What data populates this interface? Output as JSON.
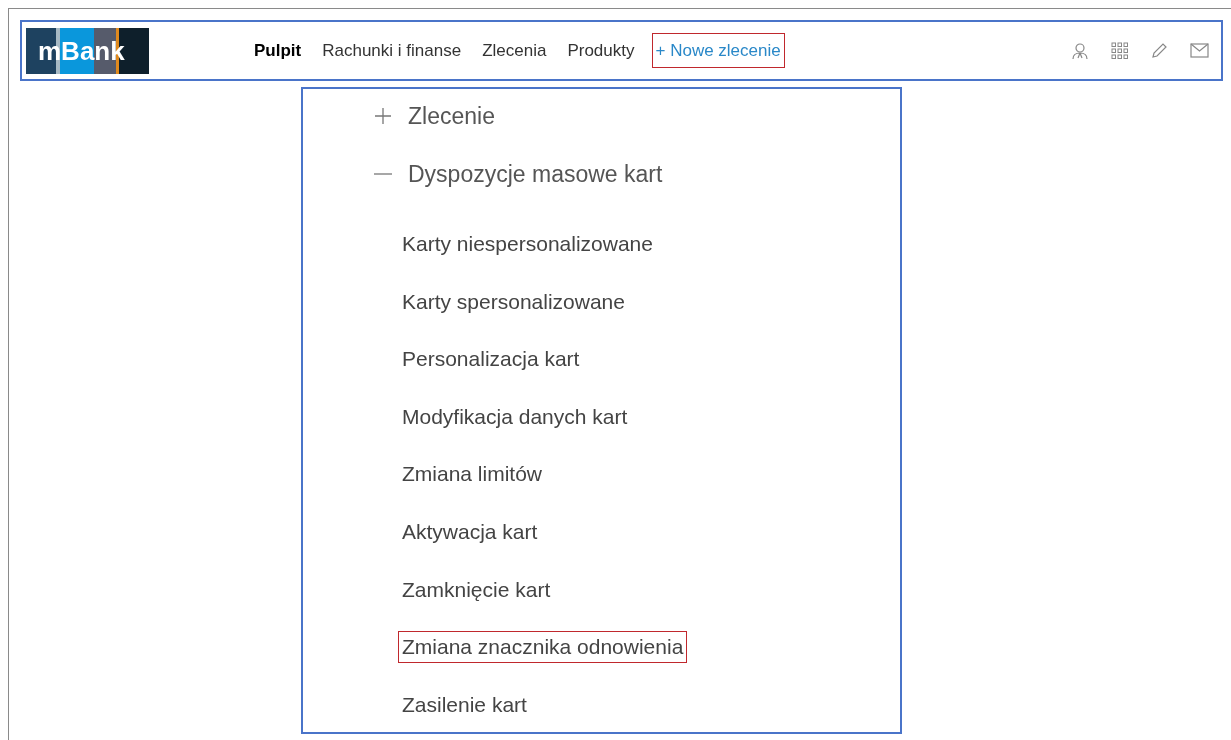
{
  "logo": {
    "text": "mBank"
  },
  "nav": [
    {
      "label": "Pulpit",
      "selected": true,
      "highlighted": false
    },
    {
      "label": "Rachunki i finanse",
      "selected": false,
      "highlighted": false
    },
    {
      "label": "Zlecenia",
      "selected": false,
      "highlighted": false
    },
    {
      "label": "Produkty",
      "selected": false,
      "highlighted": false
    },
    {
      "label": "+ Nowe zlecenie",
      "selected": false,
      "highlighted": true
    }
  ],
  "menu": [
    {
      "label": "Zlecenie",
      "expanded": false
    },
    {
      "label": "Dyspozycje masowe kart",
      "expanded": true,
      "children": [
        {
          "label": "Karty niespersonalizowane",
          "highlighted": false
        },
        {
          "label": "Karty spersonalizowane",
          "highlighted": false
        },
        {
          "label": "Personalizacja kart",
          "highlighted": false
        },
        {
          "label": "Modyfikacja danych kart",
          "highlighted": false
        },
        {
          "label": "Zmiana limitów",
          "highlighted": false
        },
        {
          "label": "Aktywacja kart",
          "highlighted": false
        },
        {
          "label": "Zamknięcie kart",
          "highlighted": false
        },
        {
          "label": "Zmiana znacznika odnowienia",
          "highlighted": true
        },
        {
          "label": "Zasilenie kart",
          "highlighted": false
        }
      ]
    }
  ]
}
